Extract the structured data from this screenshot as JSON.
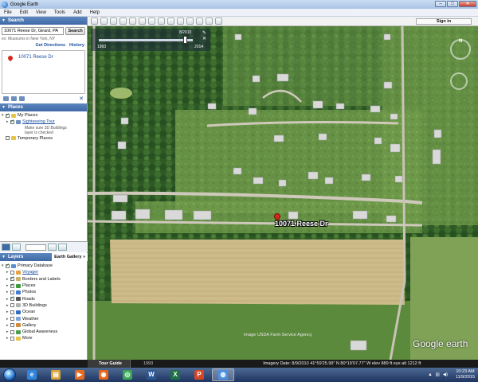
{
  "window": {
    "title": "Google Earth",
    "controls": {
      "minimize": "–",
      "maximize": "□",
      "close": "✕"
    }
  },
  "menubar": [
    "File",
    "Edit",
    "View",
    "Tools",
    "Add",
    "Help"
  ],
  "toolbar": {
    "sign_in": "Sign in",
    "icons": [
      "sidebar-icon",
      "placemark-icon",
      "polygon-icon",
      "path-icon",
      "image-overlay-icon",
      "record-tour-icon",
      "historical-imagery-icon",
      "sun-icon",
      "planets-icon",
      "ruler-icon",
      "email-icon",
      "print-icon",
      "save-image-icon",
      "view-in-maps-icon"
    ]
  },
  "search": {
    "header": "Search",
    "query": "10071 Reese Dr, Girard, PA",
    "button": "Search",
    "hint": "ex: Museums in New York, NY",
    "get_directions": "Get Directions",
    "history": "History",
    "result_label": "10071 Reese Dr"
  },
  "places": {
    "header": "Places",
    "items": [
      {
        "label": "My Places",
        "checked": true,
        "expand": "▾",
        "icon_color": "#e8c34a",
        "link": false
      },
      {
        "label": "Sightseeing Tour",
        "checked": true,
        "expand": "▸",
        "icon_color": "#6d8fbf",
        "link": true
      },
      {
        "label": "Temporary Places",
        "checked": false,
        "expand": "",
        "icon_color": "#e8c34a",
        "link": false
      }
    ],
    "note_line1": "Make sure 3D Buildings",
    "note_line2": "layer is checked"
  },
  "layers": {
    "header": "Layers",
    "gallery_tab": "Earth Gallery",
    "gallery_arrow": "»",
    "items": [
      {
        "label": "Primary Database",
        "checked": true,
        "icon_color": "#5a8fd0",
        "link": false
      },
      {
        "label": "Voyager",
        "checked": false,
        "icon_color": "#e8a040",
        "link": true
      },
      {
        "label": "Borders and Labels",
        "checked": true,
        "icon_color": "#c9b36a",
        "link": false
      },
      {
        "label": "Places",
        "checked": true,
        "icon_color": "#3b9a3b",
        "link": false
      },
      {
        "label": "Photos",
        "checked": false,
        "icon_color": "#3e7fd1",
        "link": false
      },
      {
        "label": "Roads",
        "checked": true,
        "icon_color": "#555555",
        "link": false
      },
      {
        "label": "3D Buildings",
        "checked": false,
        "icon_color": "#b0b0b0",
        "link": false
      },
      {
        "label": "Ocean",
        "checked": false,
        "icon_color": "#2e6fc0",
        "link": false
      },
      {
        "label": "Weather",
        "checked": false,
        "icon_color": "#7aa7d8",
        "link": false
      },
      {
        "label": "Gallery",
        "checked": false,
        "icon_color": "#d08a3a",
        "link": false
      },
      {
        "label": "Global Awareness",
        "checked": false,
        "icon_color": "#4a9e4a",
        "link": false
      },
      {
        "label": "More",
        "checked": false,
        "icon_color": "#e8c34a",
        "link": false
      }
    ]
  },
  "timeslider": {
    "start_year": "1993",
    "end_year": "2014",
    "current_date": "8/2010",
    "position": 0.92
  },
  "map": {
    "placemark_label": "10071 Reese Dr",
    "copyright": "Image USDA Farm Service Agency",
    "logo": "Google earth",
    "compass_n": "N"
  },
  "statusbar": {
    "tour_guide": "Tour Guide",
    "year": "1993",
    "info": "Imagery Date: 8/9/2010   41°59'25.99\" N  80°19'07.77\" W  elev 889 ft   eye alt 1212 ft"
  },
  "taskbar": {
    "apps": [
      {
        "name": "ie-icon",
        "glyph": "e",
        "color": "#2e86de",
        "active": false
      },
      {
        "name": "explorer-icon",
        "glyph": "▤",
        "color": "#d9a43a",
        "active": false
      },
      {
        "name": "media-player-icon",
        "glyph": "▶",
        "color": "#e96b1f",
        "active": false
      },
      {
        "name": "firefox-icon",
        "glyph": "◉",
        "color": "#e8641b",
        "active": false
      },
      {
        "name": "chrome-icon",
        "glyph": "◎",
        "color": "#3aa757",
        "active": false
      },
      {
        "name": "word-icon",
        "glyph": "W",
        "color": "#2b5797",
        "active": false
      },
      {
        "name": "excel-icon",
        "glyph": "X",
        "color": "#1e7145",
        "active": false
      },
      {
        "name": "powerpoint-icon",
        "glyph": "P",
        "color": "#d24726",
        "active": false
      },
      {
        "name": "google-earth-icon",
        "glyph": "◍",
        "color": "#4a90e2",
        "active": true
      }
    ],
    "time": "10:23 AM",
    "date": "11/9/2015"
  }
}
